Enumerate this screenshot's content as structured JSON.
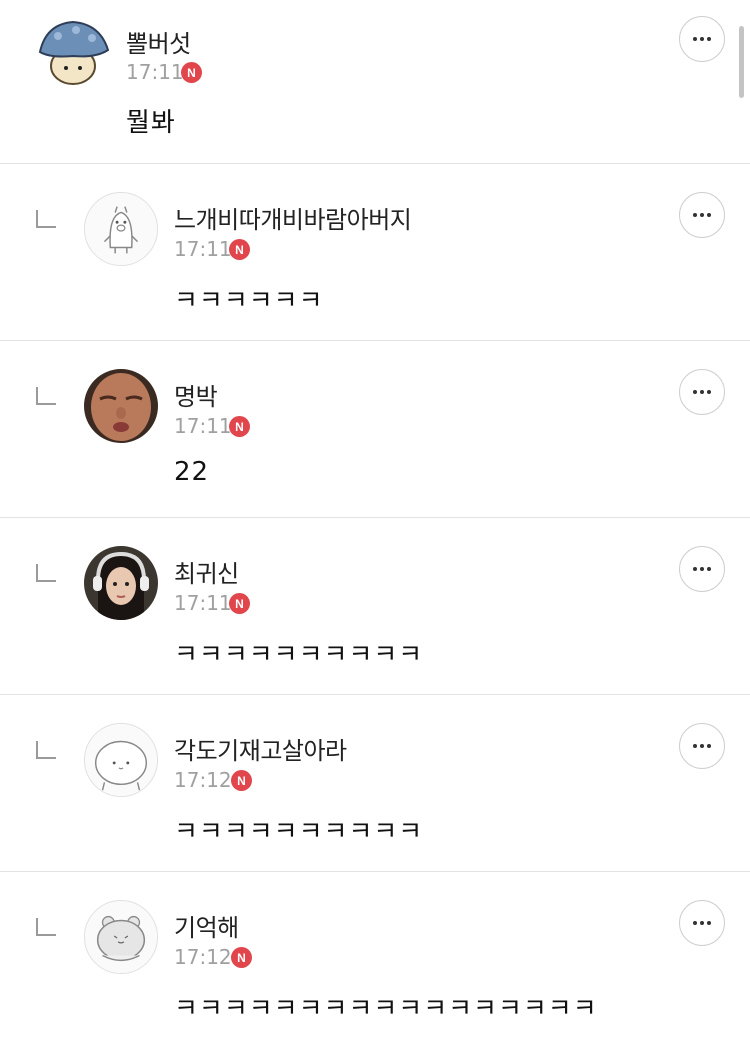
{
  "comments": [
    {
      "nickname": "뽈버섯",
      "time": "17:11",
      "badge": "N",
      "text": "뭘봐",
      "reply": false,
      "avatar": "mushroom-avatar"
    },
    {
      "nickname": "느개비따개비바람아버지",
      "time": "17:11",
      "badge": "N",
      "text": "ㅋㅋㅋㅋㅋㅋ",
      "reply": true,
      "avatar": "penguin-avatar"
    },
    {
      "nickname": "명박",
      "time": "17:11",
      "badge": "N",
      "text": "22",
      "reply": true,
      "avatar": "man-face-avatar"
    },
    {
      "nickname": "최귀신",
      "time": "17:11",
      "badge": "N",
      "text": "ㅋㅋㅋㅋㅋㅋㅋㅋㅋㅋ",
      "reply": true,
      "avatar": "woman-headphones-avatar"
    },
    {
      "nickname": "각도기재고살아라",
      "time": "17:12",
      "badge": "N",
      "text": "ㅋㅋㅋㅋㅋㅋㅋㅋㅋㅋ",
      "reply": true,
      "avatar": "blob-avatar"
    },
    {
      "nickname": "기억해",
      "time": "17:12",
      "badge": "N",
      "text": "ㅋㅋㅋㅋㅋㅋㅋㅋㅋㅋㅋㅋㅋㅋㅋㅋㅋ",
      "reply": true,
      "avatar": "bear-avatar"
    }
  ],
  "icons": {
    "more": "more-options-icon",
    "reply": "reply-indent-icon"
  },
  "colors": {
    "badge": "#e0464b",
    "time": "#a0a0a0",
    "divider": "#e3e3e3"
  }
}
